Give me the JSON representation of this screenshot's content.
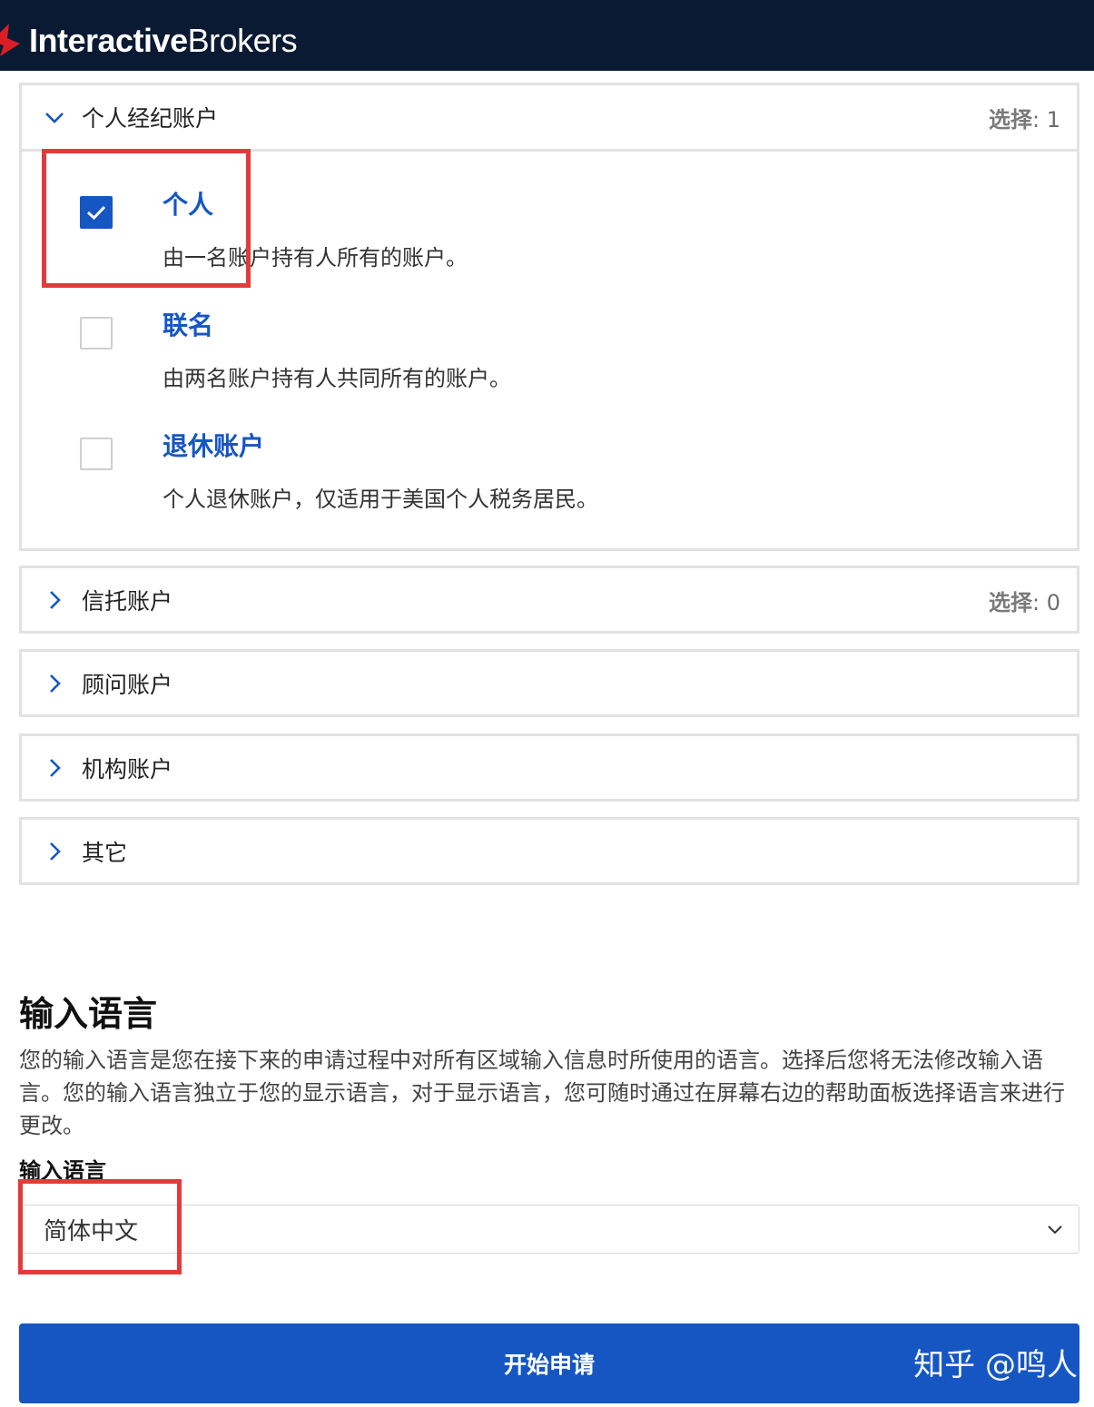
{
  "header": {
    "logo_bold": "Interactive",
    "logo_regular": "Brokers"
  },
  "accordion": {
    "individual": {
      "title": "个人经纪账户",
      "select_label": "选择",
      "select_count": ": 1",
      "expanded": true,
      "options": [
        {
          "title": "个人",
          "description": "由一名账户持有人所有的账户。",
          "checked": true
        },
        {
          "title": "联名",
          "description": "由两名账户持有人共同所有的账户。",
          "checked": false
        },
        {
          "title": "退休账户",
          "description": "个人退休账户，仅适用于美国个人税务居民。",
          "checked": false
        }
      ]
    },
    "trust": {
      "title": "信托账户",
      "select_label": "选择",
      "select_count": ": 0"
    },
    "advisor": {
      "title": "顾问账户"
    },
    "institution": {
      "title": "机构账户"
    },
    "other": {
      "title": "其它"
    }
  },
  "input_language": {
    "heading": "输入语言",
    "paragraph": "您的输入语言是您在接下来的申请过程中对所有区域输入信息时所使用的语言。选择后您将无法修改输入语言。您的输入语言独立于您的显示语言，对于显示语言，您可随时通过在屏幕右边的帮助面板选择语言来进行更改。",
    "field_label": "输入语言",
    "selected_value": "简体中文"
  },
  "actions": {
    "start_label": "开始申请"
  },
  "watermark": "知乎 @鸣人",
  "colors": {
    "topbar": "#0b1a33",
    "accent": "#1556c3",
    "highlight": "#e23b3b",
    "logo_red": "#d81f26"
  },
  "icons": {
    "expanded": "chevron-down-icon",
    "collapsed": "chevron-right-icon",
    "checked": "checkmark-icon",
    "select": "chevron-down-icon"
  }
}
